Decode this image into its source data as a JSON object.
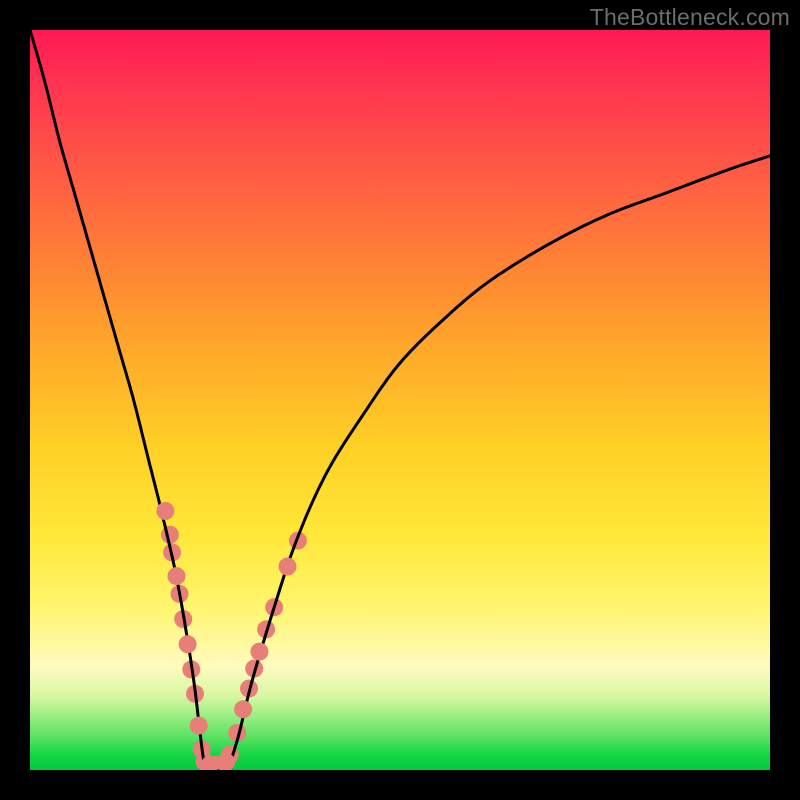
{
  "watermark": "TheBottleneck.com",
  "colors": {
    "frame_border": "#000000",
    "curve": "#000000",
    "dot_fill": "#e77e77",
    "watermark_text": "#6d6d6d"
  },
  "chart_data": {
    "type": "line",
    "title": "",
    "xlabel": "",
    "ylabel": "",
    "xlim": [
      0,
      100
    ],
    "ylim": [
      0,
      100
    ],
    "grid": false,
    "note": "Axes have no visible tick labels; curve shape and dot positions estimated proportionally from the image (origin at bottom-left within the gradient area). y-values are 'bottleneck' style (high = red/top, 0 = green/bottom).",
    "series": [
      {
        "name": "bottleneck-curve",
        "x": [
          0,
          2,
          4,
          6,
          8,
          10,
          12,
          14,
          16,
          18,
          20,
          22,
          23.7,
          25,
          26.5,
          28,
          30,
          33,
          36,
          40,
          45,
          50,
          56,
          62,
          70,
          78,
          86,
          94,
          100
        ],
        "y": [
          100,
          93,
          85,
          78,
          71,
          64,
          57,
          50,
          42,
          34,
          25,
          13,
          0,
          0,
          0,
          4,
          12,
          22,
          31,
          40,
          48,
          55,
          61,
          66,
          71,
          75,
          78,
          81,
          83
        ]
      }
    ],
    "dots": [
      {
        "x": 18.3,
        "y": 35.0
      },
      {
        "x": 18.9,
        "y": 31.8
      },
      {
        "x": 19.2,
        "y": 29.4
      },
      {
        "x": 19.8,
        "y": 26.2
      },
      {
        "x": 20.2,
        "y": 23.8
      },
      {
        "x": 20.7,
        "y": 20.4
      },
      {
        "x": 21.3,
        "y": 17.0
      },
      {
        "x": 21.8,
        "y": 13.6
      },
      {
        "x": 22.3,
        "y": 10.3
      },
      {
        "x": 22.8,
        "y": 6.0
      },
      {
        "x": 23.2,
        "y": 2.8
      },
      {
        "x": 23.6,
        "y": 1.1
      },
      {
        "x": 24.3,
        "y": 0.7
      },
      {
        "x": 25.2,
        "y": 0.7
      },
      {
        "x": 26.0,
        "y": 0.7
      },
      {
        "x": 26.5,
        "y": 1.1
      },
      {
        "x": 27.0,
        "y": 2.1
      },
      {
        "x": 28.0,
        "y": 5.0
      },
      {
        "x": 28.8,
        "y": 8.2
      },
      {
        "x": 29.6,
        "y": 11.0
      },
      {
        "x": 30.3,
        "y": 13.7
      },
      {
        "x": 31.0,
        "y": 16.0
      },
      {
        "x": 31.9,
        "y": 19.0
      },
      {
        "x": 33.0,
        "y": 22.0
      },
      {
        "x": 34.8,
        "y": 27.5
      },
      {
        "x": 36.2,
        "y": 31.0
      }
    ],
    "dot_radius_px": 9
  }
}
